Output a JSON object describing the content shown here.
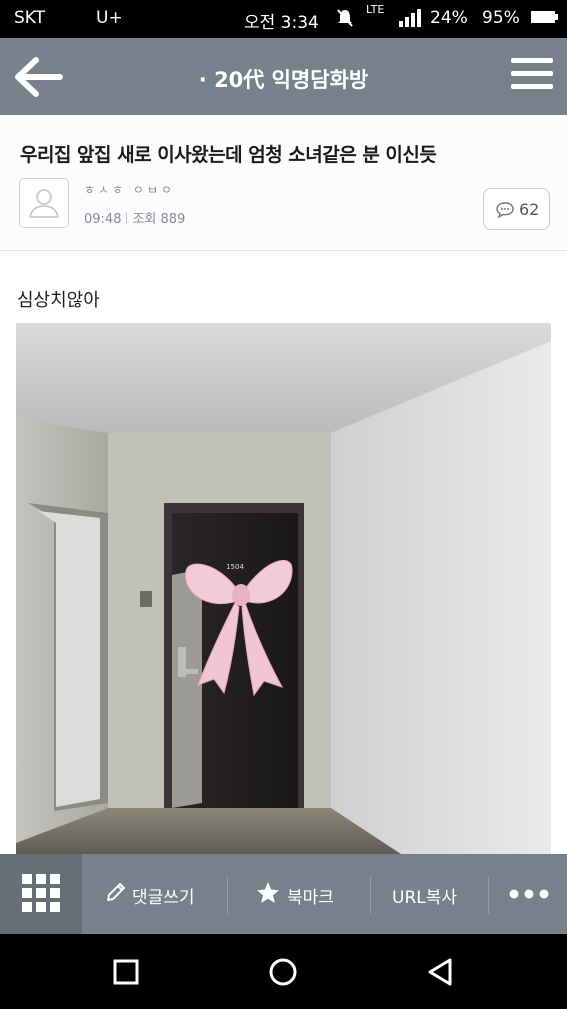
{
  "status_bar": {
    "carrier": "SKT",
    "carrier2": "U+",
    "time": "오전 3:34",
    "network": "LTE",
    "battery1": "24%",
    "battery2": "95%"
  },
  "app_bar": {
    "title": "· 20代 익명담화방",
    "back_icon": "arrow-left",
    "menu_icon": "hamburger"
  },
  "post": {
    "title": "우리집 앞집 새로 이사왔는데 엄청 소녀같은 분 이신듯",
    "author": "ㅎㅅㅎ ㅇㅂㅇ",
    "time": "09:48",
    "views": "조회 889",
    "comment_count": "62",
    "body_text": "심상치않아",
    "door_number": "1504"
  },
  "toolbar": {
    "write_comment": "댓글쓰기",
    "bookmark": "북마크",
    "copy_url": "URL복사"
  },
  "colors": {
    "app_bar": "#77818b",
    "grid_button": "#656f78",
    "header_bg": "#fefbff"
  }
}
